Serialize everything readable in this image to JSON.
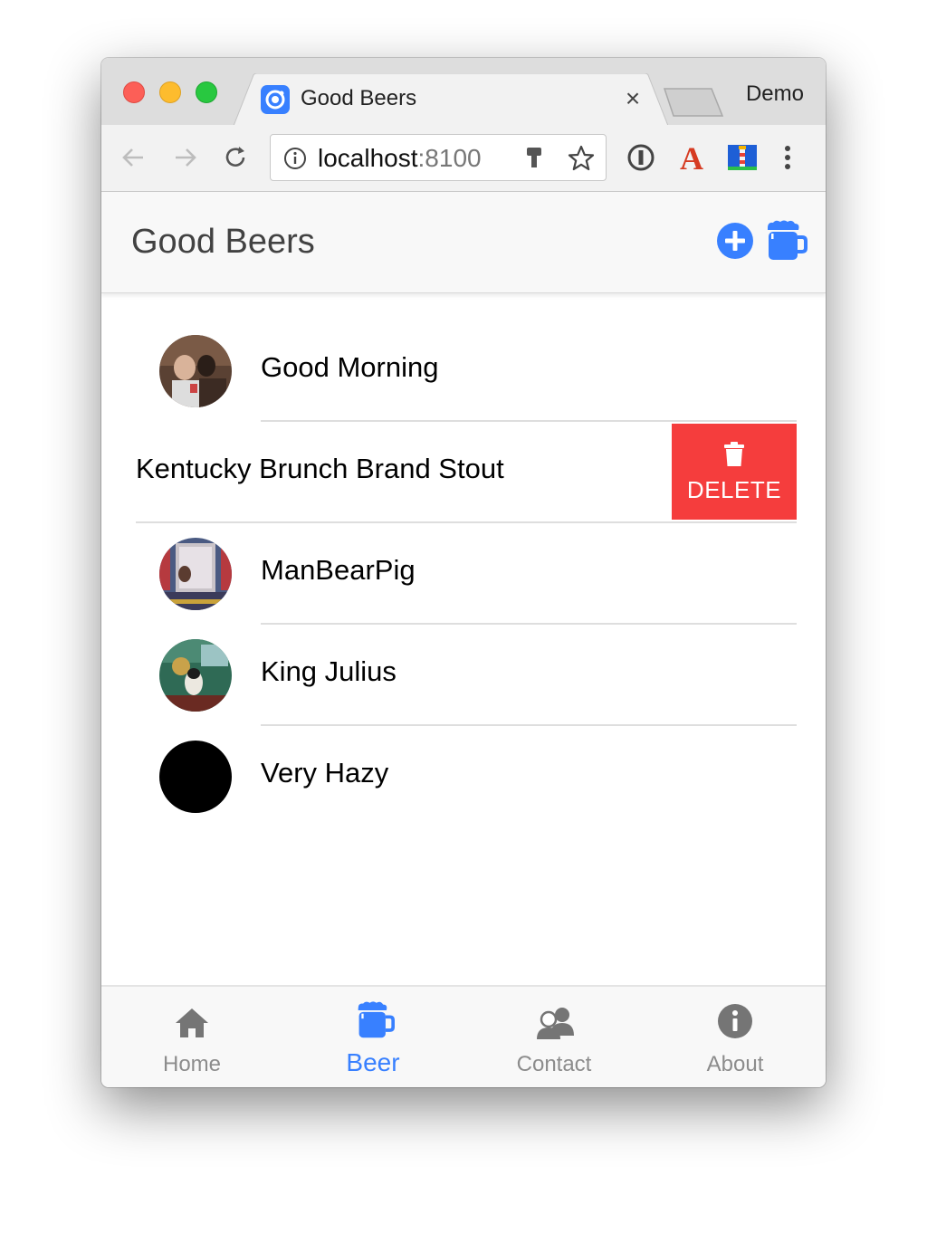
{
  "browser": {
    "tab_title": "Good Beers",
    "tab_close": "×",
    "profile_name": "Demo",
    "url_host": "localhost",
    "url_port": ":8100"
  },
  "header": {
    "title": "Good Beers",
    "add_icon": "add-circle-icon",
    "beer_icon": "beer-icon"
  },
  "list": {
    "items": [
      {
        "name": "Good Morning",
        "avatar": "photo"
      },
      {
        "name": "Kentucky Brunch Brand Stout",
        "avatar": "none"
      },
      {
        "name": "ManBearPig",
        "avatar": "photo"
      },
      {
        "name": "King Julius",
        "avatar": "photo"
      },
      {
        "name": "Very Hazy",
        "avatar": "black"
      }
    ],
    "delete_label": "DELETE"
  },
  "tabs": [
    {
      "label": "Home",
      "icon": "home-icon",
      "active": false
    },
    {
      "label": "Beer",
      "icon": "beer-icon",
      "active": true
    },
    {
      "label": "Contact",
      "icon": "contact-icon",
      "active": false
    },
    {
      "label": "About",
      "icon": "info-icon",
      "active": false
    }
  ],
  "colors": {
    "primary": "#3880ff",
    "danger": "#f53d3d",
    "tab_inactive": "#8c8c8c"
  }
}
